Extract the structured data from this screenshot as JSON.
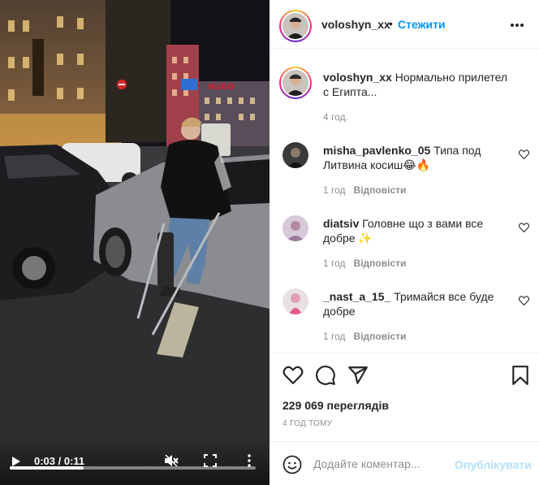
{
  "video": {
    "time_display": "0:03 / 0:11",
    "progress": 0.3,
    "sign_text": "HUGO"
  },
  "header": {
    "username": "voloshyn_xx",
    "dot": "•",
    "follow_label": "Стежити"
  },
  "caption": {
    "username": "voloshyn_xx",
    "text": "Нормально прилетел с Египта...",
    "time": "4 год."
  },
  "comments": [
    {
      "username": "misha_pavlenko_05",
      "text": "Типа под Литвина косиш😂🔥",
      "time": "1 год",
      "reply_label": "Відповісти"
    },
    {
      "username": "diatsiv",
      "text": "Головне що з вами все добре ✨",
      "time": "1 год",
      "reply_label": "Відповісти"
    },
    {
      "username": "_nast_a_15_",
      "text": "Тримайся все буде добре",
      "time": "1 год",
      "reply_label": "Відповісти"
    }
  ],
  "stats": {
    "views": "229 069 переглядів",
    "posted_ago": "4 ГОД ТОМУ"
  },
  "add_comment": {
    "placeholder": "Додайте коментар...",
    "publish_label": "Опублікувати"
  },
  "icons": [
    "play-icon",
    "mute-icon",
    "fullscreen-icon",
    "more-vertical-icon",
    "more-horizontal-icon",
    "heart-icon",
    "comment-icon",
    "share-icon",
    "bookmark-icon",
    "emoji-icon"
  ],
  "colors": {
    "accent": "#0095f6",
    "publish_disabled": "#b2dffc",
    "muted_text": "#8e8e8e"
  }
}
